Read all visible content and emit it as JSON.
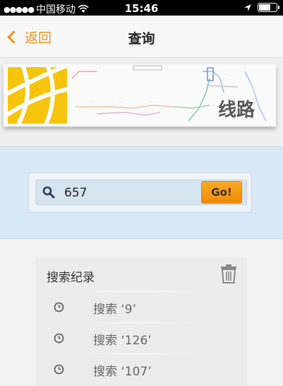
{
  "status_bar": {
    "carrier": "中国移动",
    "time": "15:46",
    "signal_icon": "signal-dots-icon",
    "wifi_icon": "wifi-icon",
    "location_icon": "location-arrow-icon",
    "battery_level": 0.6
  },
  "nav": {
    "back_label": "返回",
    "title": "查询"
  },
  "banner": {
    "text": "线路",
    "logo_color": "#f6c40c"
  },
  "search": {
    "value": "657",
    "button_label": "Go!"
  },
  "history": {
    "title": "搜索纪录",
    "items": [
      {
        "label": "搜索 ‘9’"
      },
      {
        "label": "搜索 ‘126’"
      },
      {
        "label": "搜索 ‘107’"
      }
    ]
  },
  "colors": {
    "accent": "#f0901c",
    "search_bg": "#d8eaf7"
  }
}
